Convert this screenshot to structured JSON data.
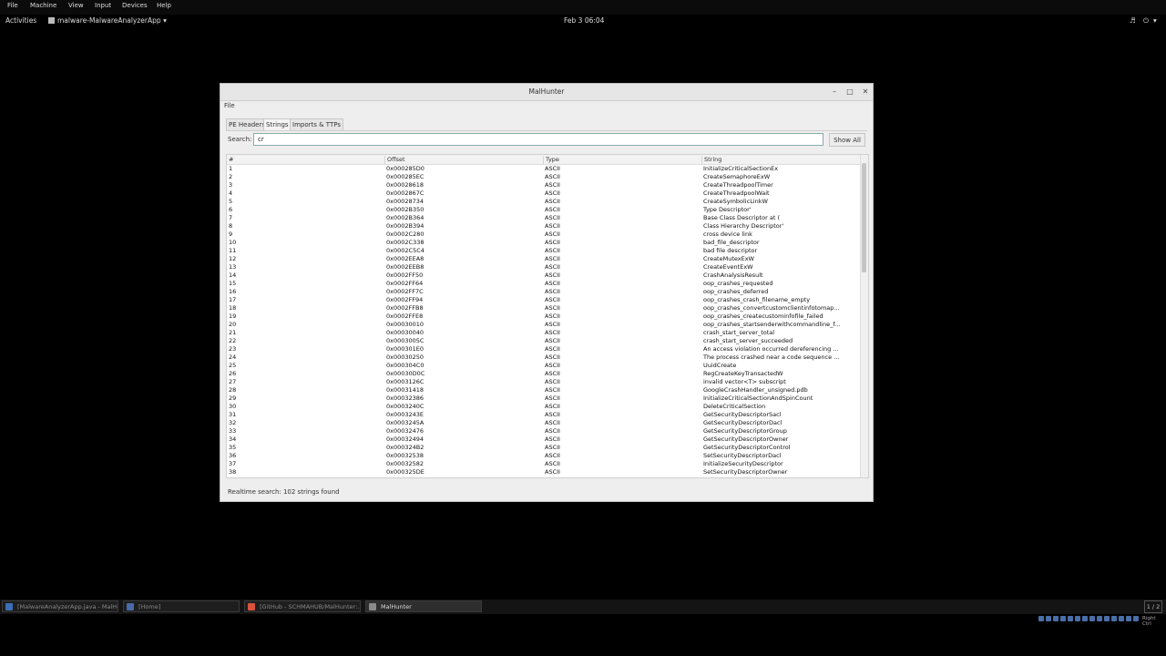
{
  "vbox_menu": [
    "File",
    "Machine",
    "View",
    "Input",
    "Devices",
    "Help"
  ],
  "topbar": {
    "activities": "Activities",
    "app_menu": "malware-MalwareAnalyzerApp",
    "clock": "Feb 3  06:04"
  },
  "window": {
    "title": "MalHunter",
    "menu_file": "File",
    "tabs": [
      "PE Headers",
      "Strings",
      "Imports & TTPs"
    ],
    "active_tab": "Strings",
    "search_label": "Search:",
    "search_value": "cr",
    "show_all": "Show All",
    "columns": [
      "#",
      "Offset",
      "Type",
      "String"
    ],
    "rows": [
      [
        "1",
        "0x000285D0",
        "ASCII",
        "InitializeCriticalSectionEx"
      ],
      [
        "2",
        "0x000285EC",
        "ASCII",
        "CreateSemaphoreExW"
      ],
      [
        "3",
        "0x00028618",
        "ASCII",
        "CreateThreadpoolTimer"
      ],
      [
        "4",
        "0x0002867C",
        "ASCII",
        "CreateThreadpoolWait"
      ],
      [
        "5",
        "0x00028734",
        "ASCII",
        "CreateSymbolicLinkW"
      ],
      [
        "6",
        "0x0002B350",
        "ASCII",
        " Type Descriptor'"
      ],
      [
        "7",
        "0x0002B364",
        "ASCII",
        " Base Class Descriptor at ("
      ],
      [
        "8",
        "0x0002B394",
        "ASCII",
        " Class Hierarchy Descriptor'"
      ],
      [
        "9",
        "0x0002C280",
        "ASCII",
        "cross device link"
      ],
      [
        "10",
        "0x0002C338",
        "ASCII",
        "bad_file_descriptor"
      ],
      [
        "11",
        "0x0002C5C4",
        "ASCII",
        "bad file descriptor"
      ],
      [
        "12",
        "0x0002EEA8",
        "ASCII",
        "CreateMutexExW"
      ],
      [
        "13",
        "0x0002EEB8",
        "ASCII",
        "CreateEventExW"
      ],
      [
        "14",
        "0x0002FF50",
        "ASCII",
        "CrashAnalysisResult"
      ],
      [
        "15",
        "0x0002FF64",
        "ASCII",
        "oop_crashes_requested"
      ],
      [
        "16",
        "0x0002FF7C",
        "ASCII",
        "oop_crashes_deferred"
      ],
      [
        "17",
        "0x0002FF94",
        "ASCII",
        "oop_crashes_crash_filename_empty"
      ],
      [
        "18",
        "0x0002FFB8",
        "ASCII",
        "oop_crashes_convertcustomclientinfotomap..."
      ],
      [
        "19",
        "0x0002FFE8",
        "ASCII",
        "oop_crashes_createcustominfofile_failed"
      ],
      [
        "20",
        "0x00030010",
        "ASCII",
        "oop_crashes_startsenderwithcommandline_f..."
      ],
      [
        "21",
        "0x00030040",
        "ASCII",
        "crash_start_server_total"
      ],
      [
        "22",
        "0x0003005C",
        "ASCII",
        "crash_start_server_succeeded"
      ],
      [
        "23",
        "0x000301E0",
        "ASCII",
        "An access violation occurred dereferencing ..."
      ],
      [
        "24",
        "0x00030250",
        "ASCII",
        "The process crashed near a code sequence ..."
      ],
      [
        "25",
        "0x000304C0",
        "ASCII",
        "UuidCreate"
      ],
      [
        "26",
        "0x00030D0C",
        "ASCII",
        "RegCreateKeyTransactedW"
      ],
      [
        "27",
        "0x0003126C",
        "ASCII",
        "invalid vector<T> subscript"
      ],
      [
        "28",
        "0x00031418",
        "ASCII",
        "GoogleCrashHandler_unsigned.pdb"
      ],
      [
        "29",
        "0x00032386",
        "ASCII",
        "InitializeCriticalSectionAndSpinCount"
      ],
      [
        "30",
        "0x0003240C",
        "ASCII",
        "DeleteCriticalSection"
      ],
      [
        "31",
        "0x0003243E",
        "ASCII",
        "GetSecurityDescriptorSacl"
      ],
      [
        "32",
        "0x0003245A",
        "ASCII",
        "GetSecurityDescriptorDacl"
      ],
      [
        "33",
        "0x00032476",
        "ASCII",
        "GetSecurityDescriptorGroup"
      ],
      [
        "34",
        "0x00032494",
        "ASCII",
        "GetSecurityDescriptorOwner"
      ],
      [
        "35",
        "0x000324B2",
        "ASCII",
        "GetSecurityDescriptorControl"
      ],
      [
        "36",
        "0x00032538",
        "ASCII",
        "SetSecurityDescriptorDacl"
      ],
      [
        "37",
        "0x00032582",
        "ASCII",
        "InitializeSecurityDescriptor"
      ],
      [
        "38",
        "0x000325DE",
        "ASCII",
        "SetSecurityDescriptorOwner"
      ]
    ],
    "status": "Realtime search: 102 strings found"
  },
  "taskbar": {
    "items": [
      {
        "label": "[MalwareAnalyzerApp.java - MalHu...",
        "active": false,
        "icon_color": "#3b6fb6"
      },
      {
        "label": "[Home]",
        "active": false,
        "icon_color": "#4a6aa8"
      },
      {
        "label": "[GitHub - SCHMAHUB/MalHunter:...",
        "active": false,
        "icon_color": "#d9533a"
      },
      {
        "label": "MalHunter",
        "active": true,
        "icon_color": "#8a8a8a"
      }
    ],
    "pager": "1 / 2"
  },
  "statusbar": {
    "host_key": "Right Ctrl"
  }
}
